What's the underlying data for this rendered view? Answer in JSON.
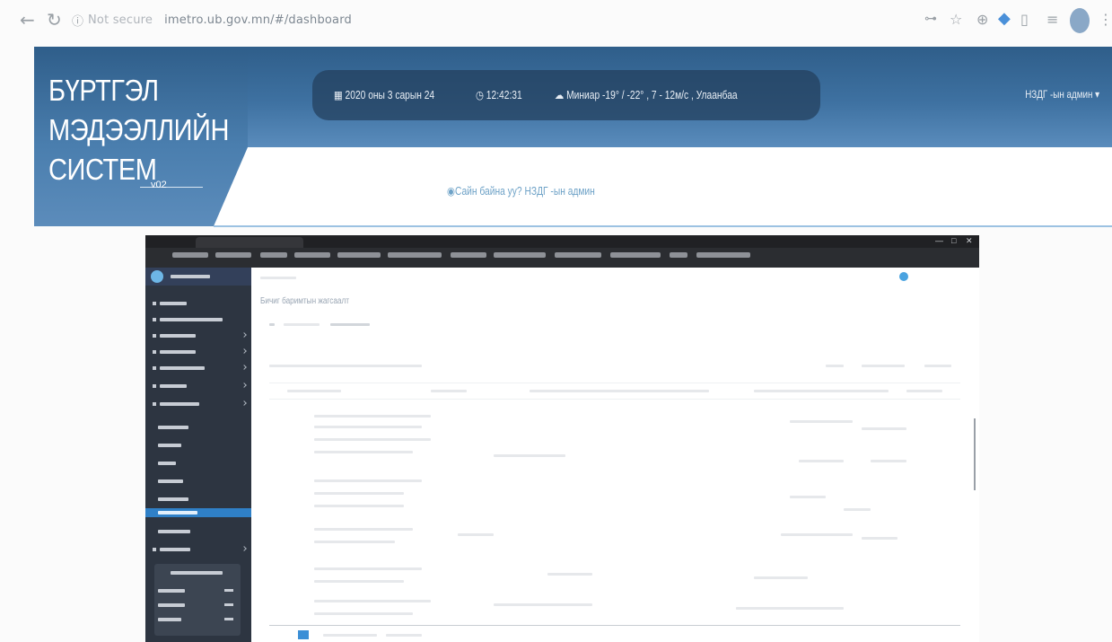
{
  "browser": {
    "back_icon": "back-arrow-icon",
    "reload_icon": "reload-icon",
    "security_label": "Not secure",
    "url": "imetro.ub.gov.mn/#/dashboard"
  },
  "app": {
    "logo_lines": [
      "БҮРТГЭЛ",
      "МЭДЭЭЛЛИЙН",
      "СИСТЕМ"
    ],
    "version": "v02",
    "date": "2020 оны 3 сарын 24",
    "time": "12:42:31",
    "weather": "Миниар -19° / -22° , 7 - 12м/с , Улаанбаа",
    "user_menu": "НЗДГ -ын админ",
    "welcome": "Сайн байна уу? НЗДГ -ын админ"
  },
  "embedded": {
    "title": "Бичиг баримтын жагсаалт",
    "active_page": "1"
  },
  "colors": {
    "header_blue": "#3e71a1",
    "sidebar_dark": "#2d3541",
    "accent": "#2f80c7"
  }
}
